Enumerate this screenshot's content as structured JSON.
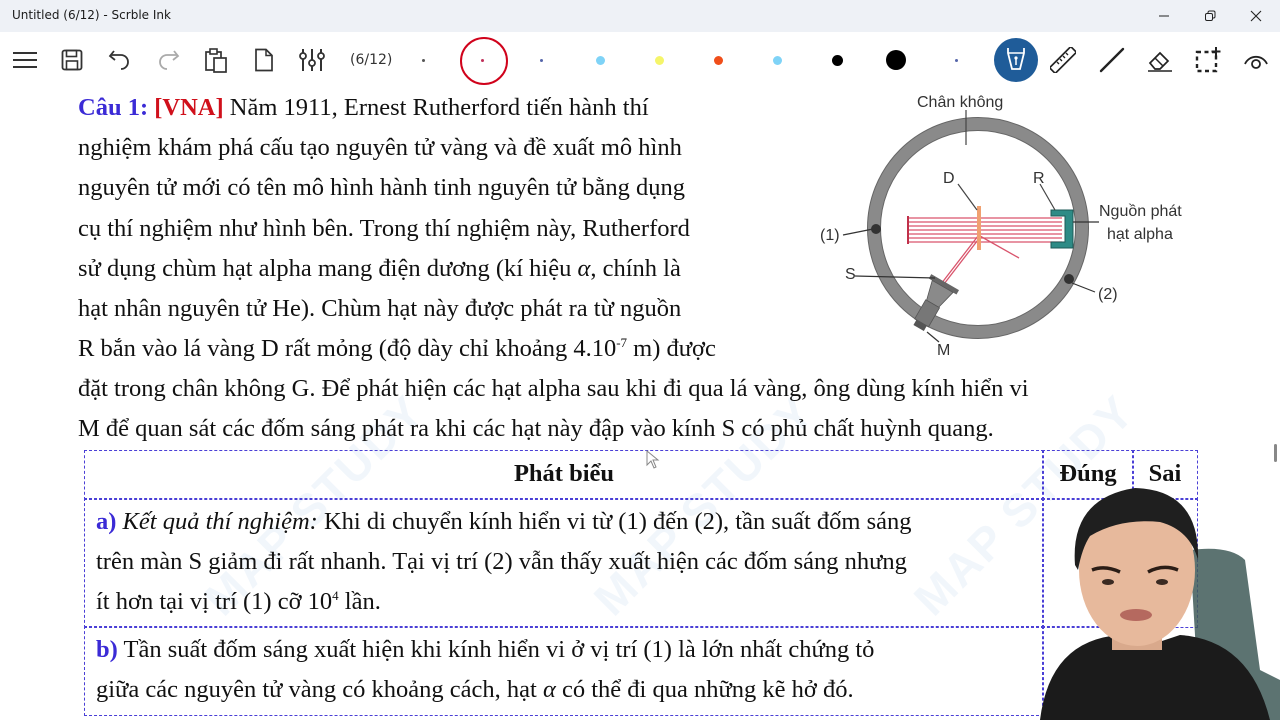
{
  "window": {
    "title": "Untitled (6/12) - Scrble Ink",
    "controls": [
      "minimize",
      "restore",
      "close"
    ]
  },
  "toolbar": {
    "buttons": [
      {
        "name": "menu",
        "icon": "hamburger-icon"
      },
      {
        "name": "save",
        "icon": "save-icon"
      },
      {
        "name": "undo",
        "icon": "undo-icon"
      },
      {
        "name": "redo",
        "icon": "redo-icon",
        "disabled": true
      },
      {
        "name": "paste",
        "icon": "clipboard-icon"
      },
      {
        "name": "new-page",
        "icon": "page-icon"
      },
      {
        "name": "settings",
        "icon": "sliders-icon"
      }
    ],
    "page_indicator": "(6/12)",
    "pen_swatches": [
      {
        "color": "#555555",
        "size": "tiny"
      },
      {
        "color": "#c0305a",
        "size": "tiny",
        "selected": true
      },
      {
        "color": "#5566aa",
        "size": "tiny"
      },
      {
        "color": "#7fd3f7",
        "size": "small"
      },
      {
        "color": "#f5f56a",
        "size": "small"
      },
      {
        "color": "#f04e1a",
        "size": "small"
      },
      {
        "color": "#7fd3f7",
        "size": "small"
      },
      {
        "color": "#000000",
        "size": "medium"
      },
      {
        "color": "#000000",
        "size": "large"
      },
      {
        "color": "#5566aa",
        "size": "tiny"
      }
    ],
    "tools": [
      {
        "name": "pen",
        "icon": "fountain-pen-icon",
        "active": true,
        "accent": "#1f5c99"
      },
      {
        "name": "ruler",
        "icon": "ruler-icon"
      },
      {
        "name": "line",
        "icon": "line-icon"
      },
      {
        "name": "eraser",
        "icon": "eraser-icon"
      },
      {
        "name": "select",
        "icon": "selection-icon"
      },
      {
        "name": "view",
        "icon": "eye-icon"
      }
    ]
  },
  "document": {
    "question_label": "Câu 1:",
    "source_tag": "[VNA]",
    "intro_lines": [
      " Năm 1911, Ernest Rutherford tiến hành thí",
      "nghiệm khám phá cấu tạo nguyên tử vàng và đề xuất mô hình",
      "nguyên tử mới có tên mô hình hành tinh nguyên tử bằng dụng",
      "cụ thí nghiệm như hình bên. Trong thí nghiệm này, Rutherford",
      "sử dụng chùm hạt alpha mang điện dương (kí hiệu ",
      ", chính là",
      "hạt nhân nguyên tử He). Chùm hạt này được phát ra từ nguồn",
      "R bắn vào lá vàng D rất mỏng (độ dày chỉ khoảng 4.10",
      " m) được"
    ],
    "alpha_symbol": "α",
    "thickness_exponent": "-7",
    "full_lines": [
      "đặt trong chân không G. Để phát hiện các hạt alpha sau khi đi qua lá vàng, ông dùng kính hiển vi",
      "M để quan sát các đốm sáng phát ra khi các hạt này đập vào kính S có phủ chất huỳnh quang."
    ],
    "diagram": {
      "labels": {
        "vacuum": "Chân không",
        "foil": "D",
        "source": "R",
        "source_desc_1": "Nguồn phát",
        "source_desc_2": "hạt alpha",
        "pos1": "(1)",
        "pos2": "(2)",
        "screen": "S",
        "microscope": "M"
      }
    },
    "table": {
      "headers": {
        "statement": "Phát biểu",
        "true": "Đúng",
        "false": "Sai"
      },
      "rows": [
        {
          "label": "a)",
          "italic_prefix": "Kết quả thí nghiệm:",
          "line1": " Khi di chuyển kính hiển vi từ (1) đến (2), tần suất đốm sáng",
          "line2": "trên màn S giảm đi rất nhanh. Tại vị trí (2) vẫn thấy xuất hiện các đốm sáng nhưng",
          "line3": "ít hơn tại vị trí (1) cỡ 10",
          "exp": "4",
          "line3_end": " lần."
        },
        {
          "label": "b)",
          "line1": " Tần suất đốm sáng xuất hiện khi kính hiển vi ở vị trí (1) là lớn nhất chứng tỏ",
          "line2": "giữa các nguyên tử vàng có khoảng cách, hạt ",
          "line2_end": " có thể đi qua những kẽ hở đó."
        }
      ]
    },
    "watermark": "MAP STUDY"
  }
}
